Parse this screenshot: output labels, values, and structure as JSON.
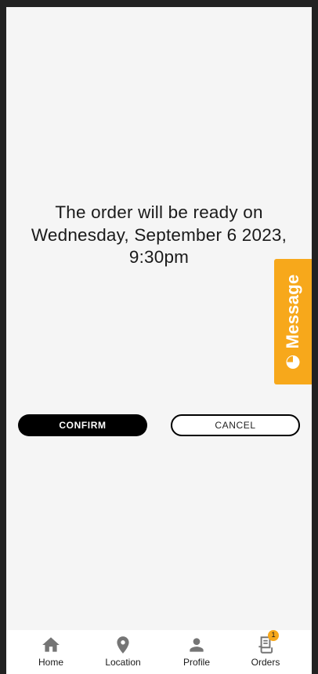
{
  "order_message": {
    "line1": "The order will be ready on",
    "line2": "Wednesday, September 6 2023,",
    "line3": "9:30pm"
  },
  "actions": {
    "confirm_label": "CONFIRM",
    "cancel_label": "CANCEL"
  },
  "message_tab": {
    "label": "Message",
    "icon": "chat-bubble-icon",
    "color": "#f7a81b"
  },
  "bottom_nav": {
    "items": [
      {
        "label": "Home",
        "icon": "home-icon"
      },
      {
        "label": "Location",
        "icon": "location-pin-icon"
      },
      {
        "label": "Profile",
        "icon": "person-icon"
      },
      {
        "label": "Orders",
        "icon": "receipt-icon",
        "badge": "1"
      }
    ]
  },
  "colors": {
    "accent": "#f7a81b",
    "primary_button": "#000000",
    "background": "#f5f5f5",
    "icon": "#757575"
  }
}
